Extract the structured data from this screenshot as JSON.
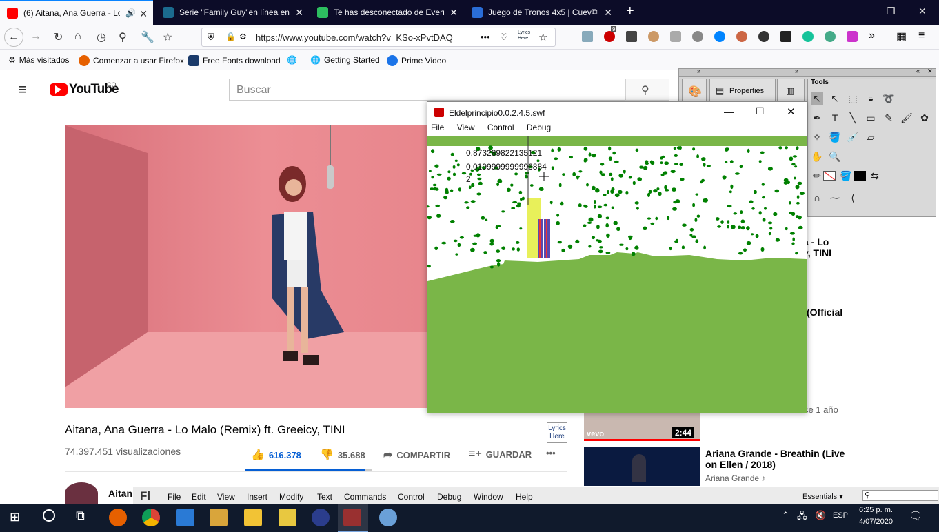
{
  "tabs": [
    {
      "label": "(6) Aitana, Ana Guerra - Lo M",
      "color": "#ff0000",
      "active": true
    },
    {
      "label": "Serie \"Family Guy\"en línea en ir",
      "color": "#1b6b8f"
    },
    {
      "label": "Te has desconectado de Everno",
      "color": "#2dbe60"
    },
    {
      "label": "Juego de Tronos 4x5 | Cueva",
      "color": "#2a6dd6"
    }
  ],
  "new_tab": "+",
  "url": "https://www.youtube.com/watch?v=KSo-xPvtDAQ",
  "url_menu": "•••",
  "lyrics_badge": "Lyrics Here",
  "abp_count": "9",
  "bookmarks": [
    {
      "label": "Más visitados"
    },
    {
      "label": "Comenzar a usar Firefox"
    },
    {
      "label": "Free Fonts download"
    },
    {
      "label": ""
    },
    {
      "label": "Getting Started"
    },
    {
      "label": "Prime Video"
    }
  ],
  "youtube": {
    "logo": "YouTube",
    "country": "CO",
    "search_placeholder": "Buscar",
    "video_title": "Aitana, Ana Guerra - Lo Malo (Remix) ft. Greeicy, TINI",
    "views": "74.397.451 visualizaciones",
    "likes": "616.378",
    "dislikes": "35.688",
    "share": "COMPARTIR",
    "save": "GUARDAR",
    "more": "•••",
    "channel": "Aitan",
    "lyrics_here": "Lyrics Here",
    "sidebar": {
      "r1a": "a - Lo",
      "r1b": "y, TINI",
      "r2": "(Official",
      "r3": "ce 1 año",
      "duration": "2:44",
      "vevo": "vevo",
      "next_title_1": "Ariana Grande - Breathin (Live",
      "next_title_2": "on Ellen / 2018)",
      "next_channel": "Ariana Grande ♪"
    }
  },
  "tools_panel": {
    "title": "Tools",
    "properties": "Properties",
    "collapse": "»"
  },
  "flash": {
    "title": "Eldelprincipio0.0.2.4.5.swf",
    "menu": [
      "File",
      "View",
      "Control",
      "Debug"
    ],
    "debug_line_1": "0.873289822135121",
    "debug_line_2": "0.0199999999996884",
    "debug_line_3": "2",
    "sky_color": "#ffffff",
    "ground_color": "#7ab648",
    "dot_color": "#008000"
  },
  "ide": {
    "logo": "Fl",
    "menu": [
      "File",
      "Edit",
      "View",
      "Insert",
      "Modify",
      "Text",
      "Commands",
      "Control",
      "Debug",
      "Window",
      "Help"
    ],
    "workspace": "Essentials ▾"
  },
  "taskbar": {
    "lang": "ESP",
    "time": "6:25 p. m.",
    "date": "4/07/2020"
  }
}
